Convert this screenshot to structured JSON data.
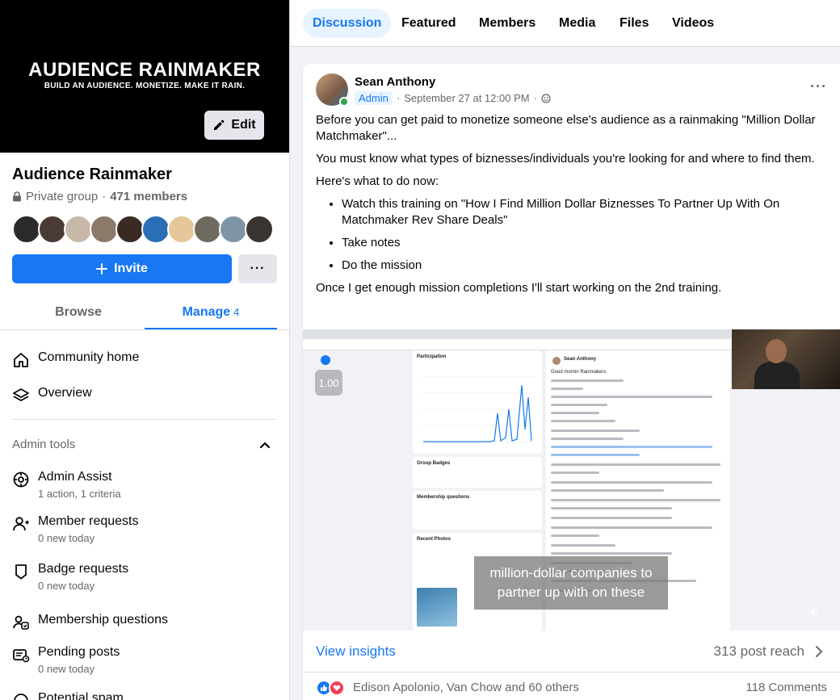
{
  "sidebar": {
    "cover": {
      "brand": "AUDIENCE RAINMAKER",
      "tagline": "BUILD AN AUDIENCE. MONETIZE. MAKE IT RAIN.",
      "edit_label": "Edit"
    },
    "group_name": "Audience Rainmaker",
    "privacy": "Private group",
    "separator": "·",
    "members": "471 members",
    "member_avatar_colors": [
      "#2b2b2b",
      "#4a3b35",
      "#c7b8a8",
      "#8c7a6b",
      "#3a2a24",
      "#2a6fb5",
      "#e5c79a",
      "#6f6a5e",
      "#7e95a8",
      "#3a3530"
    ],
    "invite_label": "Invite",
    "more_label": "···",
    "tabs": [
      {
        "label": "Browse",
        "badge": ""
      },
      {
        "label": "Manage",
        "badge": "4"
      }
    ],
    "nav": [
      {
        "title": "Community home",
        "sub": "",
        "icon": "home-icon"
      },
      {
        "title": "Overview",
        "sub": "",
        "icon": "layers-icon"
      }
    ],
    "admin_tools_label": "Admin tools",
    "admin_items": [
      {
        "title": "Admin Assist",
        "sub": "1 action, 1 criteria",
        "icon": "admin-assist-icon"
      },
      {
        "title": "Member requests",
        "sub": "0 new today",
        "icon": "member-requests-icon"
      },
      {
        "title": "Badge requests",
        "sub": "0 new today",
        "icon": "badge-icon"
      },
      {
        "title": "Membership questions",
        "sub": "",
        "icon": "membership-questions-icon"
      },
      {
        "title": "Pending posts",
        "sub": "0 new today",
        "icon": "pending-posts-icon"
      },
      {
        "title": "Potential spam",
        "sub": "",
        "icon": "spam-icon"
      }
    ]
  },
  "topbar": {
    "tabs": [
      "Discussion",
      "Featured",
      "Members",
      "Media",
      "Files",
      "Videos"
    ]
  },
  "post": {
    "author": "Sean Anthony",
    "role": "Admin",
    "timestamp": "September 27 at 12:00 PM",
    "separator": "·",
    "menu_label": "···",
    "paragraphs": [
      "Before you can get paid to monetize someone else's audience as a rainmaking \"Million Dollar Matchmaker\"...",
      "You must know what types of biznesses/individuals you're looking for and where to find them.",
      "Here's what to do now:"
    ],
    "bullets": [
      "Watch this training on \"How I Find Million Dollar Biznesses To Partner Up With On Matchmaker Rev Share Deals\"",
      "Take notes",
      "Do the mission"
    ],
    "closing": "Once I get enough mission completions I'll start working on the 2nd training.",
    "video": {
      "speed": "1.00",
      "caption": "million-dollar companies to partner up with on these",
      "participation_label": "Participation",
      "group_badges_label": "Group Badges",
      "membership_questions_label": "Membership questions",
      "recent_photos_label": "Recent Photos",
      "inner_author": "Sean Anthony",
      "inner_greeting": "Good mornin Rainmakers."
    },
    "view_insights": "View insights",
    "reach": "313 post reach",
    "reactions_text": "Edison Apolonio, Van Chow and 60 others",
    "comments": "118 Comments"
  },
  "colors": {
    "accent": "#1877f2",
    "online": "#31a24c",
    "love": "#f33e58"
  }
}
